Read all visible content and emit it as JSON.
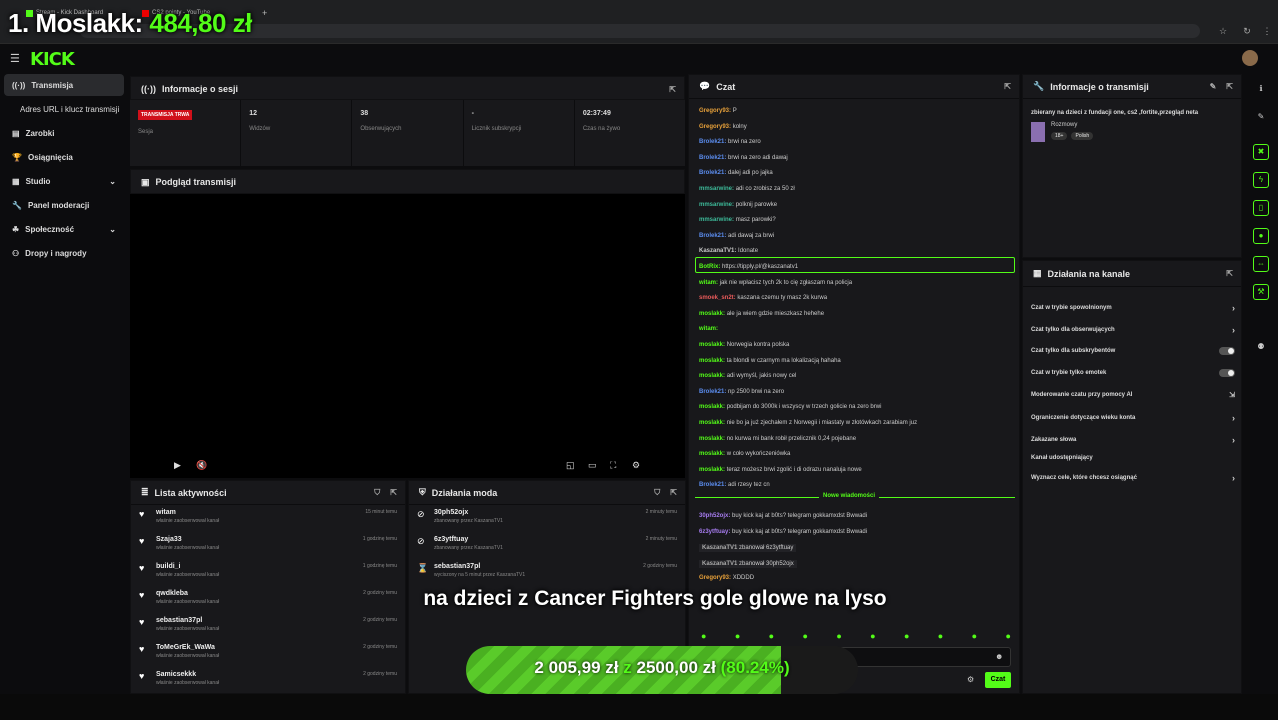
{
  "browser": {
    "tabs": [
      "Stream - Kick Dashboard",
      "CS2 pointy - YouTube"
    ],
    "new_tab": "+"
  },
  "overlay": {
    "rank": "1. Moslakk:",
    "amount": "484,80 zł",
    "subtitle": "na dzieci z Cancer Fighters gole glowe na lyso",
    "goal_current": "2 005,99 zł",
    "goal_sep": "z",
    "goal_target": "2500,00 zł",
    "goal_pct": "(80.24%)",
    "goal_fraction": 0.8024
  },
  "header": {
    "logo": "KICK"
  },
  "sidebar": {
    "items": [
      {
        "label": "Transmisja",
        "icon": "broadcast-icon",
        "active": true
      },
      {
        "label": "Adres URL i klucz transmisji",
        "icon": "",
        "active": false
      },
      {
        "label": "Zarobki",
        "icon": "wallet-icon",
        "active": false
      },
      {
        "label": "Osiągnięcia",
        "icon": "trophy-icon",
        "active": false
      },
      {
        "label": "Studio",
        "icon": "studio-icon",
        "active": false,
        "chevron": true
      },
      {
        "label": "Panel moderacji",
        "icon": "wrench-icon",
        "active": false
      },
      {
        "label": "Społeczność",
        "icon": "community-icon",
        "active": false,
        "chevron": true
      },
      {
        "label": "Dropy i nagrody",
        "icon": "gift-icon",
        "active": false
      }
    ]
  },
  "session": {
    "title": "Informacje o sesji",
    "live_badge": "TRANSMISJA TRWA",
    "stats": [
      {
        "value": "",
        "label": "Sesja"
      },
      {
        "value": "12",
        "label": "Widzów"
      },
      {
        "value": "38",
        "label": "Obserwujących"
      },
      {
        "value": "-",
        "label": "Licznik subskrypcji"
      },
      {
        "value": "02:37:49",
        "label": "Czas na żywo"
      }
    ]
  },
  "preview": {
    "title": "Podgląd transmisji"
  },
  "activity": {
    "title": "Lista aktywności",
    "rows": [
      {
        "name": "witam",
        "sub": "właśnie zaobserwował kanał",
        "time": "15 minut temu"
      },
      {
        "name": "Szaja33",
        "sub": "właśnie zaobserwował kanał",
        "time": "1 godzinę temu"
      },
      {
        "name": "buildi_i",
        "sub": "właśnie zaobserwował kanał",
        "time": "1 godzinę temu"
      },
      {
        "name": "qwdkleba",
        "sub": "właśnie zaobserwował kanał",
        "time": "2 godziny temu"
      },
      {
        "name": "sebastian37pl",
        "sub": "właśnie zaobserwował kanał",
        "time": "2 godziny temu"
      },
      {
        "name": "ToMeGrEk_WaWa",
        "sub": "właśnie zaobserwował kanał",
        "time": "2 godziny temu"
      },
      {
        "name": "Samicsekkk",
        "sub": "właśnie zaobserwował kanał",
        "time": "2 godziny temu"
      }
    ]
  },
  "modactions": {
    "title": "Działania moda",
    "rows": [
      {
        "name": "30ph52ojx",
        "sub": "zbanowany przez KaszanaTV1",
        "time": "2 minuty temu",
        "icon": "ban-icon"
      },
      {
        "name": "6z3ytftuay",
        "sub": "zbanowany przez KaszanaTV1",
        "time": "2 minuty temu",
        "icon": "ban-icon"
      },
      {
        "name": "sebastian37pl",
        "sub": "wyciszony na 5 minut przez KaszanaTV1",
        "time": "2 godziny temu",
        "icon": "hourglass-icon"
      }
    ]
  },
  "chat": {
    "title": "Czat",
    "messages": [
      {
        "user": "Gregory93:",
        "text": "P",
        "color": "#e8a13a"
      },
      {
        "user": "Gregory93:",
        "text": "kolny",
        "color": "#e8a13a"
      },
      {
        "user": "Brolek21:",
        "text": "brwi na zero",
        "color": "#5b8def"
      },
      {
        "user": "Brolek21:",
        "text": "brwi na zero adi dawaj",
        "color": "#5b8def"
      },
      {
        "user": "Brolek21:",
        "text": "dalej adi po jajka",
        "color": "#5b8def"
      },
      {
        "user": "mmsarwine:",
        "text": "adi co zrobisz za 50 zł",
        "color": "#3dbb9a"
      },
      {
        "user": "mmsarwine:",
        "text": "polknij parowke",
        "color": "#3dbb9a"
      },
      {
        "user": "mmsarwine:",
        "text": "masz parowki?",
        "color": "#3dbb9a"
      },
      {
        "user": "Brolek21:",
        "text": "adi dawaj za brwi",
        "color": "#5b8def"
      },
      {
        "user": "KaszanaTV1:",
        "text": "Idonate",
        "color": "#c9c9c9"
      },
      {
        "user": "BotRix:",
        "text": "https://tipply.pl/@kaszanatv1",
        "color": "#53fc18"
      },
      {
        "user": "witam:",
        "text": "jak nie wpłacisz tych 2k to cię zgłaszam na policja",
        "color": "#53fc18"
      },
      {
        "user": "smoek_sn2t:",
        "text": "kaszana czemu ty masz 2k kurwa",
        "color": "#e85a5a"
      },
      {
        "user": "moslakk:",
        "text": "ale ja wiem gdzie mieszkasz hehehe",
        "color": "#53fc18"
      },
      {
        "user": "witam:",
        "text": "",
        "color": "#53fc18"
      },
      {
        "user": "moslakk:",
        "text": "Norwegia kontra polska",
        "color": "#53fc18"
      },
      {
        "user": "moslakk:",
        "text": "ta blondi w czarnym ma lokalizacją hahaha",
        "color": "#53fc18"
      },
      {
        "user": "moslakk:",
        "text": "adi wymyśl, jakis nowy cel",
        "color": "#53fc18"
      },
      {
        "user": "Brolek21:",
        "text": "np 2500 brwi na zero",
        "color": "#5b8def"
      },
      {
        "user": "moslakk:",
        "text": "podbijam do 3000k i wszyscy w trzech golicie na zero brwi",
        "color": "#53fc18"
      },
      {
        "user": "moslakk:",
        "text": "nie bo ja już zjechałem z Norwegii i miastaty w złotówkach zarabiam juz",
        "color": "#53fc18"
      },
      {
        "user": "moslakk:",
        "text": "no kurwa mi bank robił przelicznik 0,24 pojebane",
        "color": "#53fc18"
      },
      {
        "user": "moslakk:",
        "text": "w coło wykończeniówka",
        "color": "#53fc18"
      },
      {
        "user": "moslakk:",
        "text": "teraz możesz brwi zgolić i di odrazu nanaluja nowe",
        "color": "#53fc18"
      },
      {
        "user": "Brolek21:",
        "text": "adi rzesy tez cn",
        "color": "#5b8def"
      }
    ],
    "new_messages_label": "Nowe wiadomości",
    "new_messages": [
      {
        "user": "30ph52ojx:",
        "text": "buy kick kaj at b0ts? telegram gokkamxdst Bwwadi",
        "color": "#a77cf0"
      },
      {
        "user": "6z3ytftuay:",
        "text": "buy kick kaj at b0ts? telegram gokkamxdst Bwwadi",
        "color": "#a77cf0"
      },
      {
        "user": "KaszanaTV1",
        "text": "zbanował 6z3ytftuay",
        "color": "#aaaaaa"
      },
      {
        "user": "KaszanaTV1",
        "text": "zbanował 30ph52ojx",
        "color": "#aaaaaa"
      },
      {
        "user": "Gregory93:",
        "text": "XDDDD",
        "color": "#e8a13a"
      }
    ],
    "send_label": "Czat"
  },
  "streaminfo": {
    "title": "Informacje o transmisji",
    "desc": "zbierany na dzieci z fundacji one, cs2 ,fortite,przegląd neta",
    "category": "Rozmowy",
    "tags": [
      "18+",
      "Polish"
    ]
  },
  "channelactions": {
    "title": "Działania na kanale",
    "options": [
      {
        "label": "Czat w trybie spowolnionym",
        "control": "chevron"
      },
      {
        "label": "Czat tylko dla obserwujących",
        "control": "chevron"
      },
      {
        "label": "Czat tylko dla subskrybentów",
        "control": "toggle"
      },
      {
        "label": "Czat w trybie tylko emotek",
        "control": "toggle"
      },
      {
        "label": "Moderowanie czatu przy pomocy AI",
        "control": "external"
      },
      {
        "label": "Ograniczenie dotyczące wieku konta",
        "control": "chevron"
      },
      {
        "label": "Zakazane słowa",
        "control": "chevron"
      },
      {
        "label": "Kanał udostępniający",
        "control": "none"
      },
      {
        "label": "Wyznacz cele, które chcesz osiągnąć",
        "control": "chevron"
      }
    ]
  },
  "colors": {
    "accent": "#53fc18",
    "panel": "#18181b",
    "live": "#d0101a"
  }
}
